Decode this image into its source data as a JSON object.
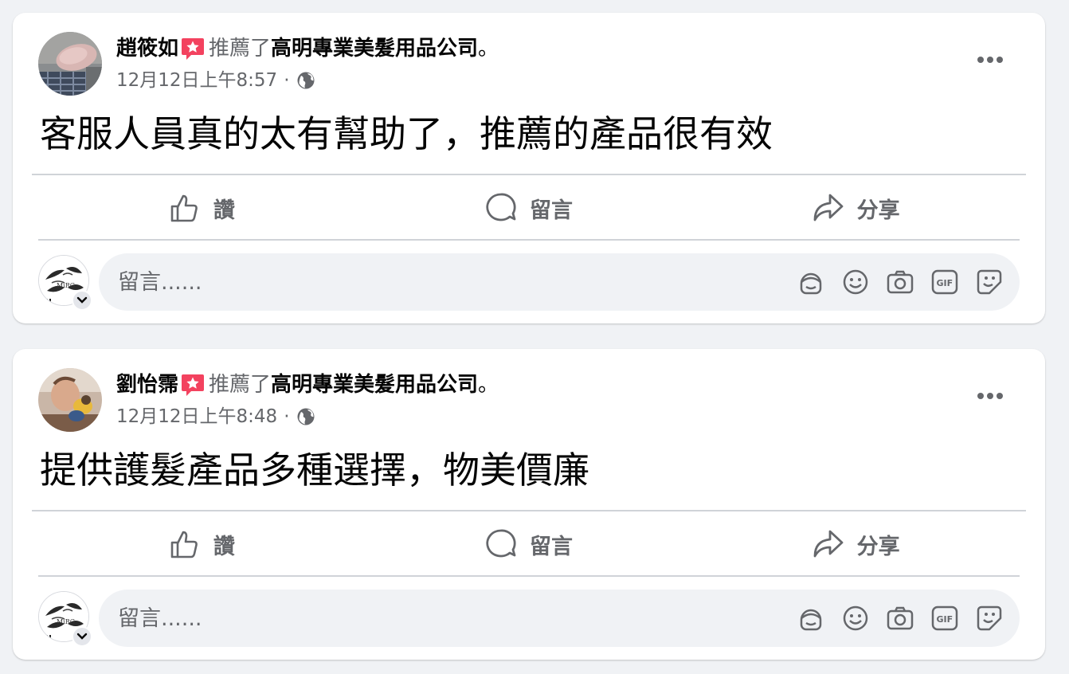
{
  "posts": [
    {
      "author": "趙筱如",
      "verb": "推薦了",
      "page_name": "高明專業美髮用品公司",
      "period": "。",
      "timestamp": "12月12日上午8:57",
      "separator": "·",
      "text": "客服人員真的太有幫助了，推薦的產品很有效"
    },
    {
      "author": "劉怡霈",
      "verb": "推薦了",
      "page_name": "高明專業美髮用品公司",
      "period": "。",
      "timestamp": "12月12日上午8:48",
      "separator": "·",
      "text": "提供護髮產品多種選擇，物美價廉"
    }
  ],
  "actions": {
    "like": "讚",
    "comment": "留言",
    "share": "分享"
  },
  "comment_box": {
    "placeholder": "留言......"
  },
  "icons": {
    "recommend_badge": "recommend-star-icon",
    "audience": "globe-icon",
    "more": "more-options-icon",
    "like": "thumbs-up-icon",
    "comment": "speech-bubble-icon",
    "share": "share-arrow-icon",
    "tools": [
      "avatar-sticker-icon",
      "emoji-icon",
      "camera-icon",
      "gif-icon",
      "sticker-icon"
    ]
  },
  "colors": {
    "background": "#f0f2f5",
    "card": "#ffffff",
    "secondary_text": "#65676b",
    "recommend_badge": "#f3425f"
  }
}
